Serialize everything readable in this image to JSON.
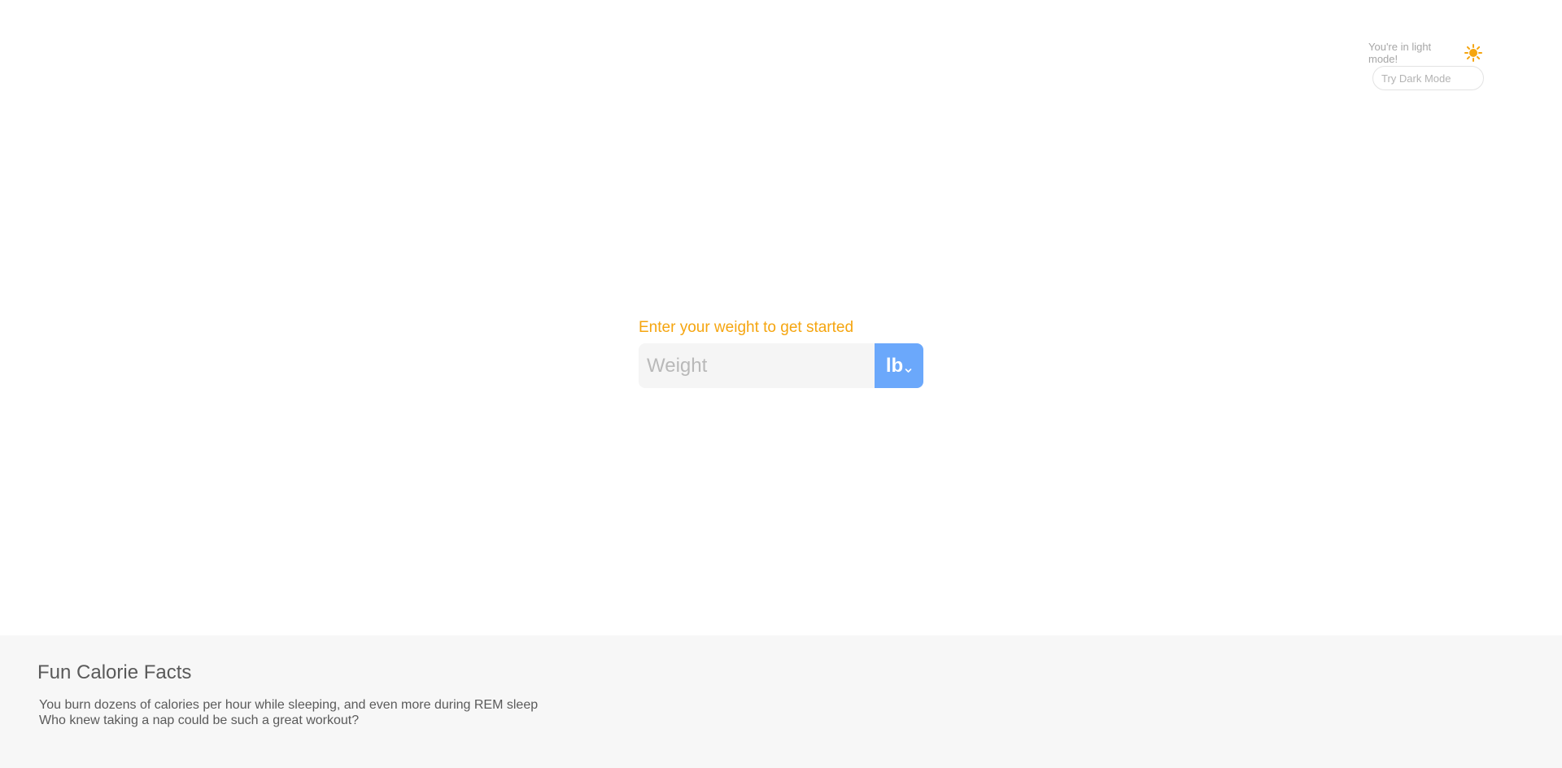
{
  "theme": {
    "status_text": "You're in light mode!",
    "status_icon": "sun-icon",
    "toggle_label": "Try Dark Mode",
    "icon_color": "#f5a50f"
  },
  "weight_form": {
    "prompt": "Enter your weight to get started",
    "input_value": "",
    "input_placeholder": "Weight",
    "unit_selected": "lb",
    "unit_icon": "chevron-down-icon",
    "accent_color": "#f5a50f",
    "unit_button_color": "#6ba8fb"
  },
  "facts": {
    "title": "Fun Calorie Facts",
    "lines": [
      "You burn dozens of calories per hour while sleeping, and even more during REM sleep",
      "Who knew taking a nap could be such a great workout?"
    ]
  }
}
